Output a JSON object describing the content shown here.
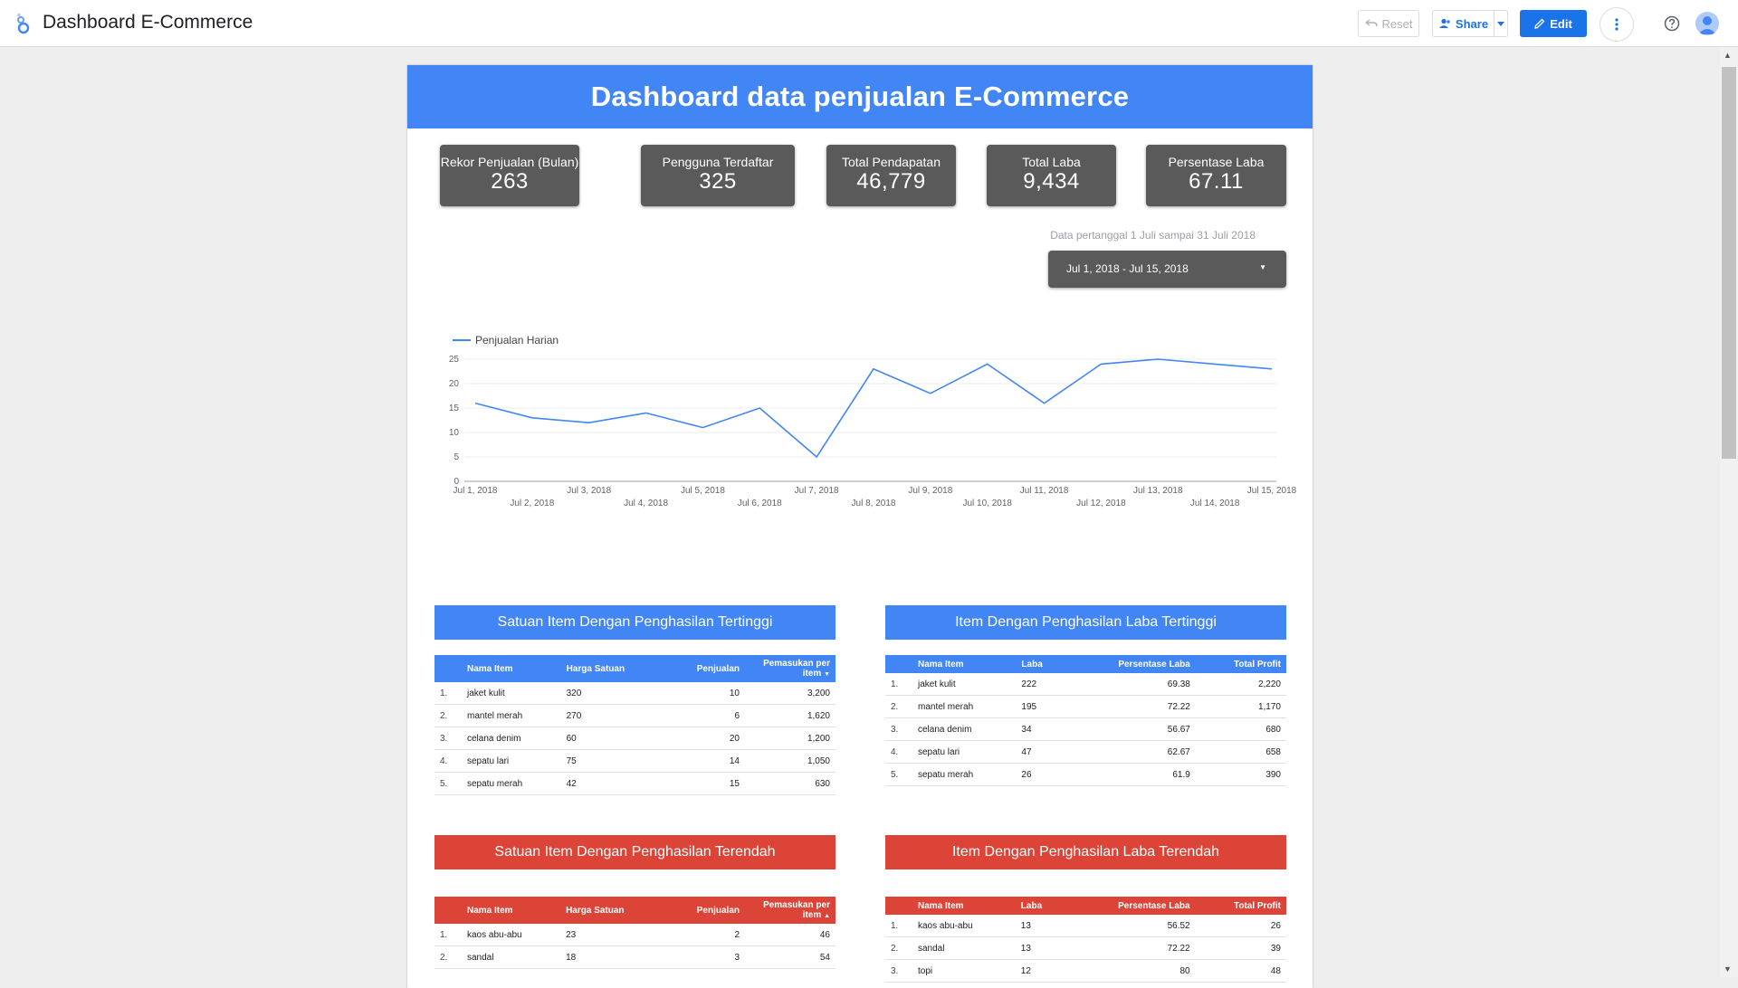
{
  "app": {
    "title": "Dashboard E-Commerce",
    "reset_label": "Reset",
    "share_label": "Share",
    "edit_label": "Edit"
  },
  "report": {
    "title": "Dashboard data penjualan E-Commerce",
    "kpis": [
      {
        "label": "Rekor Penjualan (Bulan)",
        "value": "263"
      },
      {
        "label": "Pengguna Terdaftar",
        "value": "325"
      },
      {
        "label": "Total Pendapatan",
        "value": "46,779"
      },
      {
        "label": "Total Laba",
        "value": "9,434"
      },
      {
        "label": "Persentase Laba",
        "value": "67.11"
      }
    ],
    "date_note": "Data pertanggal 1 Juli sampai 31 Juli 2018",
    "date_range": "Jul 1, 2018 - Jul 15, 2018"
  },
  "chart_data": {
    "type": "line",
    "title": "",
    "xlabel": "",
    "ylabel": "",
    "ylim": [
      0,
      25
    ],
    "yticks": [
      0,
      5,
      10,
      15,
      20,
      25
    ],
    "grid": true,
    "legend": "top-left",
    "series_color": "#4285f4",
    "categories": [
      "Jul 1, 2018",
      "Jul 2, 2018",
      "Jul 3, 2018",
      "Jul 4, 2018",
      "Jul 5, 2018",
      "Jul 6, 2018",
      "Jul 7, 2018",
      "Jul 8, 2018",
      "Jul 9, 2018",
      "Jul 10, 2018",
      "Jul 11, 2018",
      "Jul 12, 2018",
      "Jul 13, 2018",
      "Jul 14, 2018",
      "Jul 15, 2018"
    ],
    "series": [
      {
        "name": "Penjualan Harian",
        "values": [
          16,
          13,
          12,
          14,
          11,
          15,
          5,
          23,
          18,
          24,
          16,
          24,
          25,
          24,
          23
        ]
      }
    ]
  },
  "tables": {
    "top_items": {
      "title": "Satuan Item Dengan Penghasilan Tertinggi",
      "headers": [
        "Nama Item",
        "Harga Satuan",
        "Penjualan",
        "Pemasukan per item"
      ],
      "rows": [
        {
          "no": "1.",
          "name": "jaket kulit",
          "price": "320",
          "sales": "10",
          "income": "3,200"
        },
        {
          "no": "2.",
          "name": "mantel merah",
          "price": "270",
          "sales": "6",
          "income": "1,620"
        },
        {
          "no": "3.",
          "name": "celana denim",
          "price": "60",
          "sales": "20",
          "income": "1,200"
        },
        {
          "no": "4.",
          "name": "sepatu lari",
          "price": "75",
          "sales": "14",
          "income": "1,050"
        },
        {
          "no": "5.",
          "name": "sepatu merah",
          "price": "42",
          "sales": "15",
          "income": "630"
        }
      ]
    },
    "top_profit": {
      "title": "Item Dengan Penghasilan Laba Tertinggi",
      "headers": [
        "Nama Item",
        "Laba",
        "Persentase Laba",
        "Total Profit"
      ],
      "rows": [
        {
          "no": "1.",
          "name": "jaket kulit",
          "profit": "222",
          "pct": "69.38",
          "total": "2,220"
        },
        {
          "no": "2.",
          "name": "mantel merah",
          "profit": "195",
          "pct": "72.22",
          "total": "1,170"
        },
        {
          "no": "3.",
          "name": "celana denim",
          "profit": "34",
          "pct": "56.67",
          "total": "680"
        },
        {
          "no": "4.",
          "name": "sepatu lari",
          "profit": "47",
          "pct": "62.67",
          "total": "658"
        },
        {
          "no": "5.",
          "name": "sepatu merah",
          "profit": "26",
          "pct": "61.9",
          "total": "390"
        }
      ]
    },
    "low_items": {
      "title": "Satuan Item Dengan Penghasilan Terendah",
      "headers": [
        "Nama Item",
        "Harga Satuan",
        "Penjualan",
        "Pemasukan per item"
      ],
      "rows": [
        {
          "no": "1.",
          "name": "kaos abu-abu",
          "price": "23",
          "sales": "2",
          "income": "46"
        },
        {
          "no": "2.",
          "name": "sandal",
          "price": "18",
          "sales": "3",
          "income": "54"
        }
      ]
    },
    "low_profit": {
      "title": "Item Dengan Penghasilan Laba Terendah",
      "headers": [
        "Nama Item",
        "Laba",
        "Persentase Laba",
        "Total Profit"
      ],
      "rows": [
        {
          "no": "1.",
          "name": "kaos abu-abu",
          "profit": "13",
          "pct": "56.52",
          "total": "26"
        },
        {
          "no": "2.",
          "name": "sandal",
          "profit": "13",
          "pct": "72.22",
          "total": "39"
        },
        {
          "no": "3.",
          "name": "topi",
          "profit": "12",
          "pct": "80",
          "total": "48"
        }
      ]
    }
  },
  "colors": {
    "blue": "#4285f4",
    "red": "#db4437",
    "kpi_bg": "#5a5a5a",
    "edit_button": "#1a73e8"
  }
}
